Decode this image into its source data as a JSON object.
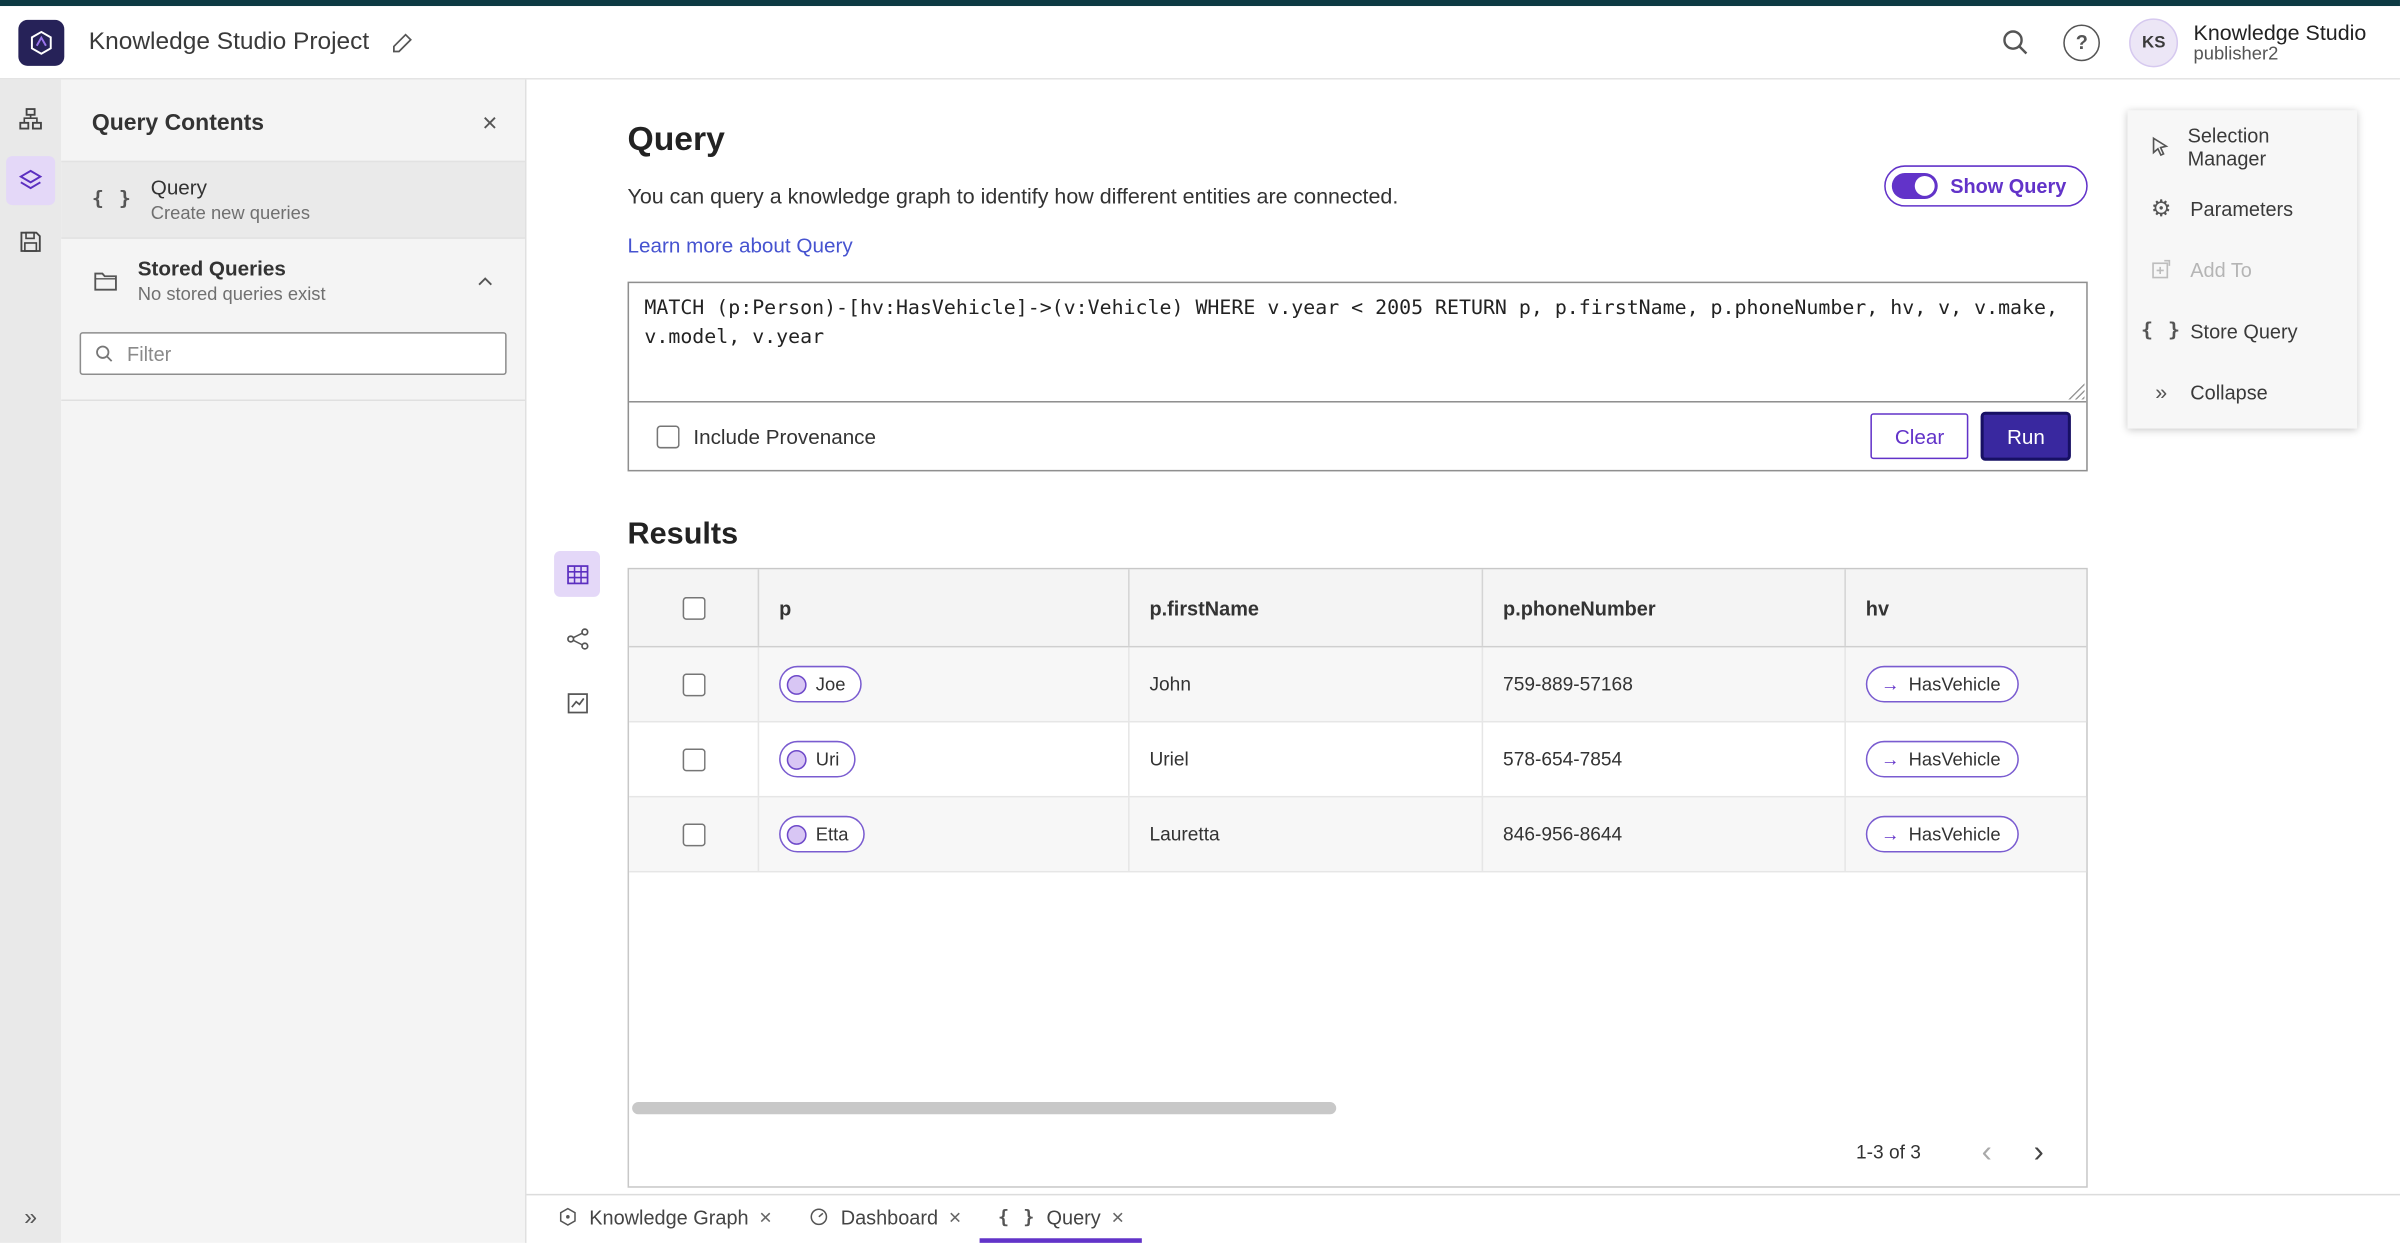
{
  "topbar": {
    "title": "Knowledge Studio Project",
    "user": {
      "initials": "KS",
      "name": "Knowledge Studio",
      "role": "publisher2"
    }
  },
  "sidebar": {
    "title": "Query Contents",
    "query_item": {
      "title": "Query",
      "subtitle": "Create new queries"
    },
    "stored": {
      "title": "Stored Queries",
      "subtitle": "No stored queries exist"
    },
    "filter_placeholder": "Filter"
  },
  "main": {
    "title": "Query",
    "description": "You can query a knowledge graph to identify how different entities are connected.",
    "learn_more": "Learn more about Query",
    "show_query": "Show Query",
    "query_text": "MATCH (p:Person)-[hv:HasVehicle]->(v:Vehicle) WHERE v.year < 2005 RETURN p, p.firstName, p.phoneNumber, hv, v, v.make, v.model, v.year",
    "include_provenance": "Include Provenance",
    "clear": "Clear",
    "run": "Run",
    "results_title": "Results"
  },
  "table": {
    "columns": [
      "p",
      "p.firstName",
      "p.phoneNumber",
      "hv"
    ],
    "rows": [
      {
        "p": "Joe",
        "firstName": "John",
        "phone": "759-889-57168",
        "hv": "HasVehicle"
      },
      {
        "p": "Uri",
        "firstName": "Uriel",
        "phone": "578-654-7854",
        "hv": "HasVehicle"
      },
      {
        "p": "Etta",
        "firstName": "Lauretta",
        "phone": "846-956-8644",
        "hv": "HasVehicle"
      }
    ],
    "pagination": "1-3 of 3"
  },
  "right_panel": {
    "items": [
      {
        "label": "Selection Manager",
        "disabled": false
      },
      {
        "label": "Parameters",
        "disabled": false
      },
      {
        "label": "Add To",
        "disabled": true
      },
      {
        "label": "Store Query",
        "disabled": false
      },
      {
        "label": "Collapse",
        "disabled": false
      }
    ]
  },
  "tabs": [
    {
      "label": "Knowledge Graph",
      "active": false
    },
    {
      "label": "Dashboard",
      "active": false
    },
    {
      "label": "Query",
      "active": true
    }
  ],
  "icons": {
    "close": "×",
    "braces": "{ }",
    "collapse": "»",
    "arrow_right": "→",
    "chevron_left": "‹",
    "chevron_right": "›",
    "question": "?",
    "gear": "⚙"
  },
  "colors": {
    "accent": "#6233c9",
    "accent_light": "#e4d8f8",
    "run": "#39289f",
    "run_border": "#171064",
    "link": "#4653d0",
    "topstrip": "#0d3a43"
  }
}
